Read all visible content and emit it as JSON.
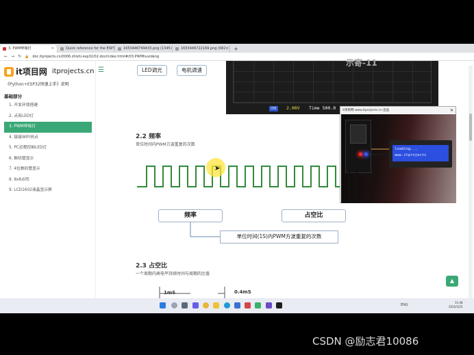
{
  "browser": {
    "tabs": [
      {
        "label": "3. PWM呼吸灯",
        "active": true
      },
      {
        "label": "Quick reference for the ESP32",
        "active": false
      },
      {
        "label": "1653446749433.png (1345×...",
        "active": false
      },
      {
        "label": "1653446722169.png (682×3...",
        "active": false
      }
    ],
    "new_tab": "+",
    "url": "doc.itprojects.cn/0006.zhishi.esp32/02.doc/index.html#/03.PWMhuxideng"
  },
  "sidebar": {
    "logo_text": "it项目网",
    "logo_domain": "itprojects.cn",
    "book_title": "《Python+ESP32快速上手》说明",
    "section_title": "基础部分",
    "items": [
      {
        "label": "1. 开发环境搭建"
      },
      {
        "label": "2. 点亮LED灯"
      },
      {
        "label": "3. PWM呼吸灯"
      },
      {
        "label": "4. 链接WIFI热点"
      },
      {
        "label": "5. PC远程控制LED灯"
      },
      {
        "label": "6. 数码管显示"
      },
      {
        "label": "7. 4位数码管显示"
      },
      {
        "label": "8. 8x8点阵"
      },
      {
        "label": "9. LCD1602液晶显示屏"
      }
    ],
    "active_index": 2
  },
  "content": {
    "pill_led": "LED调光",
    "pill_motor": "电机调速",
    "scope_channel": "CH1",
    "scope_volt": "2.00V",
    "scope_time": "Time 500.0",
    "scope_top_text": "示寄-11",
    "freq_heading": "2.2 频率",
    "freq_desc": "单位时间内PWM方波重复的次数",
    "freq_label": "频率",
    "duty_label": "占空比",
    "callout": "单位时间(1S)内PWM方波重复的次数",
    "duty_heading": "2.3 占空比",
    "duty_desc": "一个周期内高电平持续时间与周期的比值",
    "timing_1": "1mS",
    "timing_2": "0.4mS",
    "scroll_up": "▲"
  },
  "camera": {
    "title": "it项目网 www.itprojects.cn 出品",
    "lcd_line1": "loading...",
    "lcd_line2": "www.itprojects"
  },
  "taskbar": {
    "tray": "ENG",
    "time": "11:48",
    "date": "2022/5/25"
  },
  "watermark": "CSDN @励志君10086",
  "colors": {
    "accent": "#3aa876",
    "wave": "#2e8b3a",
    "lcd_blue": "#2c4fe0"
  }
}
